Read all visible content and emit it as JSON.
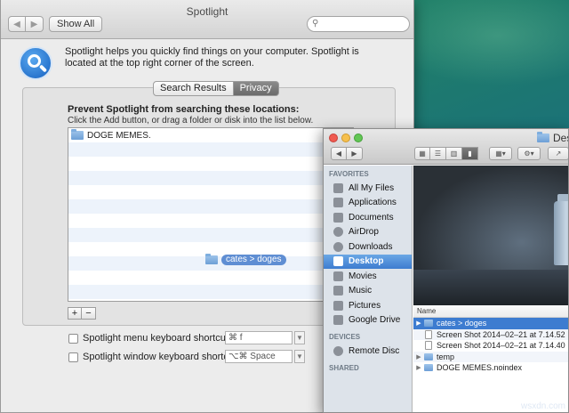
{
  "spotlight": {
    "title": "Spotlight",
    "show_all": "Show All",
    "search_placeholder": "",
    "description": "Spotlight helps you quickly find things on your computer. Spotlight is located at the top right corner of the screen.",
    "tabs": [
      {
        "label": "Search Results",
        "active": false
      },
      {
        "label": "Privacy",
        "active": true
      }
    ],
    "prevent_title": "Prevent Spotlight from searching these locations:",
    "prevent_sub": "Click the Add button, or drag a folder or disk into the list below.",
    "list_items": [
      {
        "label": "DOGE MEMES."
      }
    ],
    "drag_label": "cates > doges",
    "add": "+",
    "remove": "−",
    "shortcuts": [
      {
        "label": "Spotlight menu keyboard shortcut:",
        "value": "⌘ f",
        "checked": false
      },
      {
        "label": "Spotlight window keyboard shortcut:",
        "value": "⌥⌘ Space",
        "checked": false
      }
    ]
  },
  "finder": {
    "title": "Deskt",
    "sidebar": {
      "favorites_header": "FAVORITES",
      "favorites": [
        {
          "label": "All My Files",
          "icon": "all-files-icon"
        },
        {
          "label": "Applications",
          "icon": "applications-icon"
        },
        {
          "label": "Documents",
          "icon": "documents-icon"
        },
        {
          "label": "AirDrop",
          "icon": "airdrop-icon"
        },
        {
          "label": "Downloads",
          "icon": "downloads-icon"
        },
        {
          "label": "Desktop",
          "icon": "desktop-icon",
          "selected": true
        },
        {
          "label": "Movies",
          "icon": "movies-icon"
        },
        {
          "label": "Music",
          "icon": "music-icon"
        },
        {
          "label": "Pictures",
          "icon": "pictures-icon"
        },
        {
          "label": "Google Drive",
          "icon": "google-drive-icon"
        }
      ],
      "devices_header": "DEVICES",
      "devices": [
        {
          "label": "Remote Disc",
          "icon": "remote-disc-icon"
        }
      ],
      "shared_header": "SHARED"
    },
    "column_header": "Name",
    "files": [
      {
        "name": "cates > doges",
        "kind": "folder",
        "selected": true
      },
      {
        "name": "Screen Shot 2014–02–21 at 7.14.52",
        "kind": "doc"
      },
      {
        "name": "Screen Shot 2014–02–21 at 7.14.40",
        "kind": "doc"
      },
      {
        "name": "temp",
        "kind": "folder"
      },
      {
        "name": "DOGE MEMES.noindex",
        "kind": "folder"
      }
    ]
  },
  "watermark": "wsxdn.com",
  "colors": {
    "selection": "#3d7cd0",
    "sidebar_bg": "#dde3ea",
    "tab_active": "#6b6b6b"
  }
}
